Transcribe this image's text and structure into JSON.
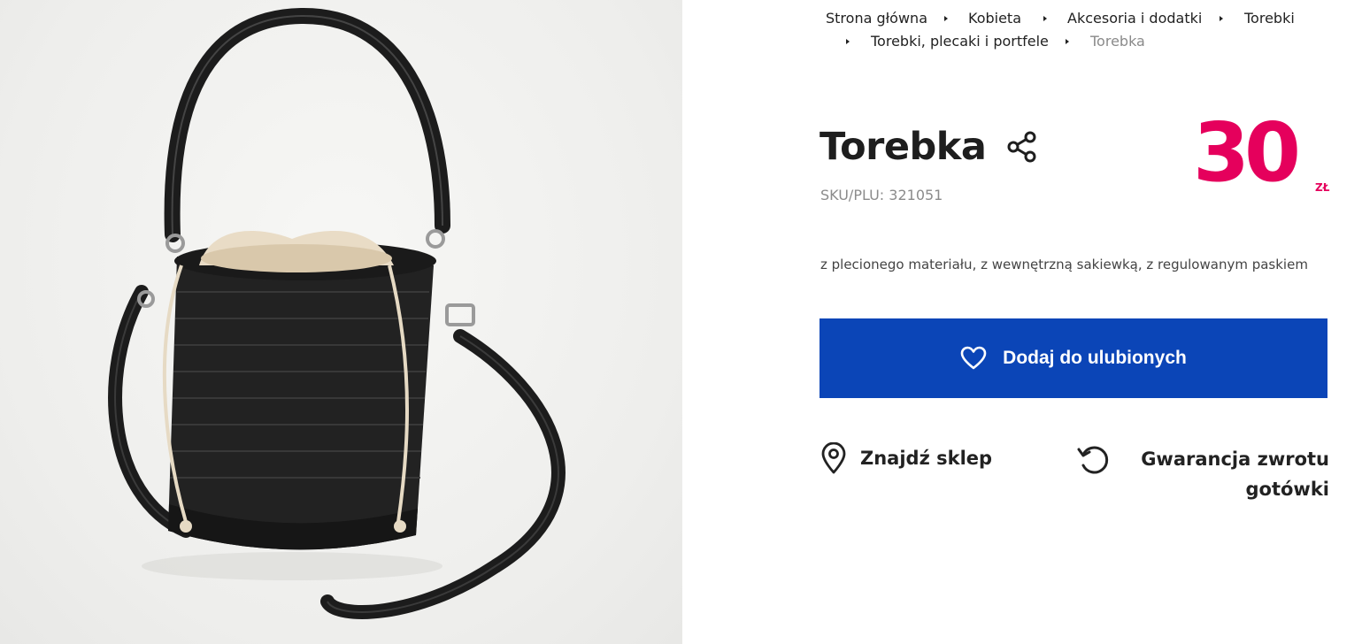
{
  "product_image": {
    "alt": "Torebka"
  },
  "breadcrumb": {
    "items": [
      "Strona główna",
      "Kobieta",
      "Akcesoria i dodatki",
      "Torebki",
      "Torebki, plecaki i portfele"
    ],
    "current": "Torebka"
  },
  "product": {
    "title": "Torebka",
    "sku": "SKU/PLU: 321051",
    "price": "30",
    "currency": "ZŁ",
    "description": "z plecionego materiału, z wewnętrzną sakiewką, z regulowanym paskiem"
  },
  "actions": {
    "favorite_label": "Dodaj do ulubionych",
    "find_store_label": "Znajdź sklep",
    "guarantee_label": "Gwarancja zwrotu gotówki"
  },
  "icons": {
    "share": "share-icon",
    "favorite": "heart-icon",
    "find_store": "location-pin-icon",
    "guarantee": "refresh-icon"
  },
  "colors": {
    "price": "#e5005c",
    "button": "#0b45b7",
    "breadcrumb_current": "#8a8a8a"
  }
}
